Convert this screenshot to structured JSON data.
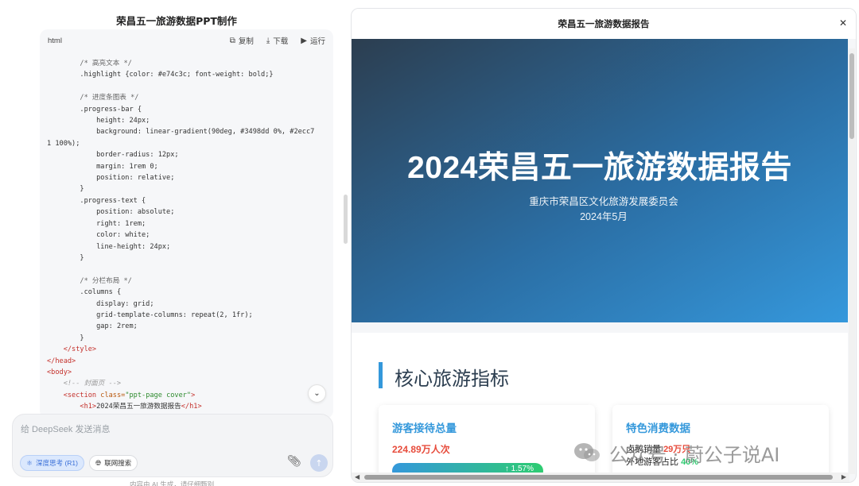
{
  "chat": {
    "title": "荣昌五一旅游数据PPT制作",
    "code_card": {
      "language": "html",
      "copy_label": "复制",
      "download_label": "下载",
      "run_label": "运行"
    },
    "code_lines": [
      {
        "indent": "        ",
        "parts": [
          [
            "c-com",
            "/* 高亮文本 */"
          ]
        ]
      },
      {
        "indent": "        ",
        "parts": [
          [
            "",
            ".highlight {color: #e74c3c; font-weight: bold;}"
          ]
        ]
      },
      {
        "indent": "",
        "parts": [
          [
            "",
            ""
          ]
        ]
      },
      {
        "indent": "        ",
        "parts": [
          [
            "c-com",
            "/* 进度条图表 */"
          ]
        ]
      },
      {
        "indent": "        ",
        "parts": [
          [
            "",
            ".progress-bar {"
          ]
        ]
      },
      {
        "indent": "            ",
        "parts": [
          [
            "",
            "height: 24px;"
          ]
        ]
      },
      {
        "indent": "            ",
        "parts": [
          [
            "",
            "background: linear-gradient(90deg, #3498dd 0%, #2ecc7"
          ]
        ]
      },
      {
        "indent": "",
        "parts": [
          [
            "",
            "1 100%);"
          ]
        ]
      },
      {
        "indent": "            ",
        "parts": [
          [
            "",
            "border-radius: 12px;"
          ]
        ]
      },
      {
        "indent": "            ",
        "parts": [
          [
            "",
            "margin: 1rem 0;"
          ]
        ]
      },
      {
        "indent": "            ",
        "parts": [
          [
            "",
            "position: relative;"
          ]
        ]
      },
      {
        "indent": "        ",
        "parts": [
          [
            "",
            "}"
          ]
        ]
      },
      {
        "indent": "        ",
        "parts": [
          [
            "",
            ".progress-text {"
          ]
        ]
      },
      {
        "indent": "            ",
        "parts": [
          [
            "",
            "position: absolute;"
          ]
        ]
      },
      {
        "indent": "            ",
        "parts": [
          [
            "",
            "right: 1rem;"
          ]
        ]
      },
      {
        "indent": "            ",
        "parts": [
          [
            "",
            "color: white;"
          ]
        ]
      },
      {
        "indent": "            ",
        "parts": [
          [
            "",
            "line-height: 24px;"
          ]
        ]
      },
      {
        "indent": "        ",
        "parts": [
          [
            "",
            "}"
          ]
        ]
      },
      {
        "indent": "",
        "parts": [
          [
            "",
            ""
          ]
        ]
      },
      {
        "indent": "        ",
        "parts": [
          [
            "c-com",
            "/* 分栏布局 */"
          ]
        ]
      },
      {
        "indent": "        ",
        "parts": [
          [
            "",
            ".columns {"
          ]
        ]
      },
      {
        "indent": "            ",
        "parts": [
          [
            "",
            "display: grid;"
          ]
        ]
      },
      {
        "indent": "            ",
        "parts": [
          [
            "",
            "grid-template-columns: repeat(2, 1fr);"
          ]
        ]
      },
      {
        "indent": "            ",
        "parts": [
          [
            "",
            "gap: 2rem;"
          ]
        ]
      },
      {
        "indent": "        ",
        "parts": [
          [
            "",
            "}"
          ]
        ]
      },
      {
        "indent": "    ",
        "parts": [
          [
            "c-tag",
            "</style>"
          ]
        ]
      },
      {
        "indent": "",
        "parts": [
          [
            "c-tag",
            "</head>"
          ]
        ]
      },
      {
        "indent": "",
        "parts": [
          [
            "c-tag",
            "<body>"
          ]
        ]
      },
      {
        "indent": "    ",
        "parts": [
          [
            "c-cmt",
            "<!-- 封面页 -->"
          ]
        ]
      },
      {
        "indent": "    ",
        "parts": [
          [
            "c-tag",
            "<section "
          ],
          [
            "c-attr",
            "class="
          ],
          [
            "c-str",
            "\"ppt-page cover\""
          ],
          [
            "c-tag",
            ">"
          ]
        ]
      },
      {
        "indent": "        ",
        "parts": [
          [
            "c-tag",
            "<h1>"
          ],
          [
            "",
            "2024荣昌五一旅游数据报告"
          ],
          [
            "c-tag",
            "</h1>"
          ]
        ]
      }
    ],
    "input": {
      "placeholder": "给 DeepSeek 发送消息",
      "deep_think_label": "深度思考 (R1)",
      "web_search_label": "联网搜索"
    },
    "disclaimer": "内容由 AI 生成，请仔细甄别"
  },
  "preview": {
    "title": "荣昌五一旅游数据报告",
    "cover": {
      "heading": "2024荣昌五一旅游数据报告",
      "org": "重庆市荣昌区文化旅游发展委员会",
      "date": "2024年5月"
    },
    "section": {
      "title": "核心旅游指标",
      "cards": [
        {
          "title": "游客接待总量",
          "value": "224.89万人次",
          "progress_text": "↑ 1.57%",
          "progress_fraction": 1.0
        },
        {
          "title": "特色消费数据",
          "line1_label": "卤鹅销量 ",
          "line1_value": "29万只",
          "line2_label": "外地游客占比 ",
          "line2_value": "40%"
        }
      ]
    }
  },
  "watermark": {
    "text": "公众号 · 蔚公子说AI"
  },
  "colors": {
    "accent": "#3498db",
    "highlight": "#e74c3c",
    "green": "#2ecc71",
    "cover_dark": "#2c3e50"
  }
}
